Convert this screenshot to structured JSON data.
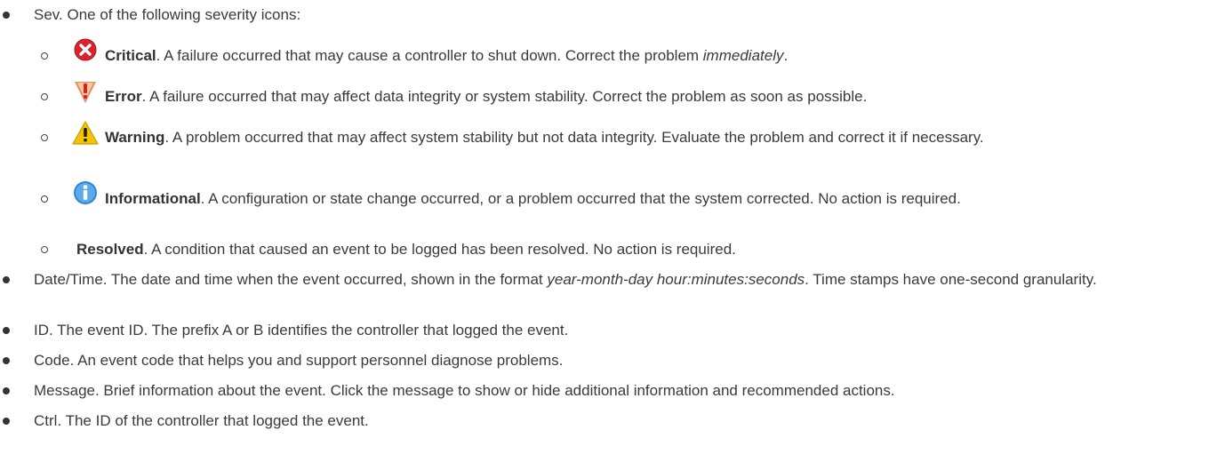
{
  "sev": {
    "text": "Sev. One of the following severity icons:",
    "levels": [
      {
        "label": "Critical",
        "text": ". A failure occurred that may cause a controller to shut down. Correct the problem ",
        "emph": "immediately",
        "after": ".",
        "icon": "critical-icon",
        "color": "#d9232a"
      },
      {
        "label": "Error",
        "text": ". A failure occurred that may affect data integrity or system stability. Correct the problem as soon as possible.",
        "icon": "error-icon",
        "color": "#e8543a"
      },
      {
        "label": "Warning",
        "text": ". A problem occurred that may affect system stability but not data integrity. Evaluate the problem and correct it if necessary.",
        "icon": "warning-icon",
        "color": "#f5c400"
      },
      {
        "label": "Informational",
        "text": ". A configuration or state change occurred, or a problem occurred that the system corrected. No action is required.",
        "icon": "info-icon",
        "color": "#2f86d6"
      },
      {
        "label": "Resolved",
        "text": ". A condition that caused an event to be logged has been resolved. No action is required."
      }
    ]
  },
  "datetime": {
    "text_before": "Date/Time. The date and time when the event occurred, shown in the format ",
    "format": "year-month-day hour:minutes:seconds",
    "text_after": ". Time stamps have one-second granularity."
  },
  "id_item": "ID. The event ID. The prefix A or B identifies the controller that logged the event.",
  "code_item": "Code. An event code that helps you and support personnel diagnose problems.",
  "message_item": "Message. Brief information about the event. Click the message to show or hide additional information and recommended actions.",
  "ctrl_item": "Ctrl. The ID of the controller that logged the event."
}
